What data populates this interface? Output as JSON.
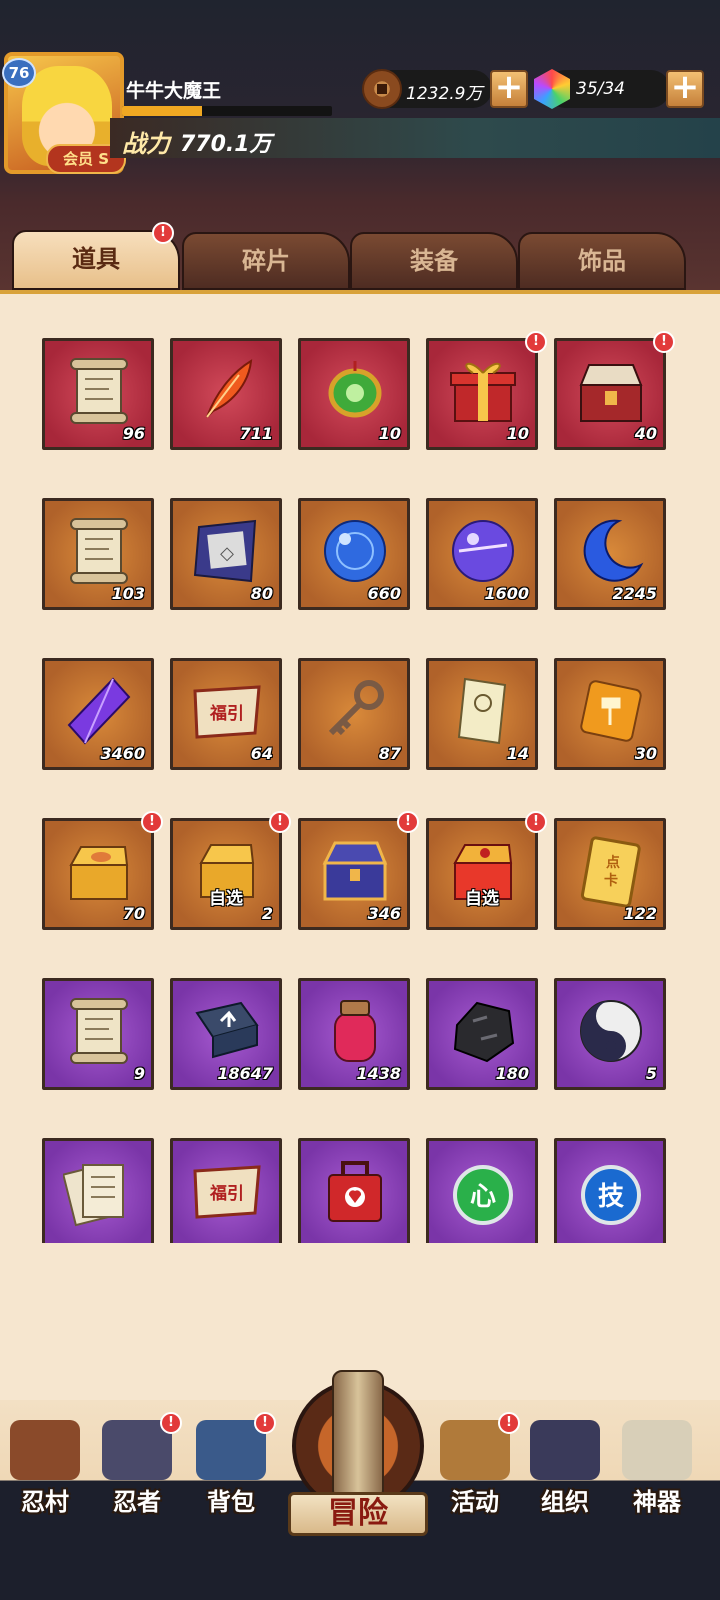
{
  "player": {
    "level": "76",
    "name": "牛牛大魔王",
    "vip_label": "会员",
    "vip_rank": "S",
    "exp_fraction": 0.38,
    "power_label": "战力",
    "power_value": "770.1万"
  },
  "resources": {
    "coins": "1232.9万",
    "gems": "35/34",
    "add_symbol": "+"
  },
  "tabs": [
    {
      "label": "道具",
      "active": true,
      "alert": true
    },
    {
      "label": "碎片",
      "active": false,
      "alert": false
    },
    {
      "label": "装备",
      "active": false,
      "alert": false
    },
    {
      "label": "饰品",
      "active": false,
      "alert": false
    }
  ],
  "alert_symbol": "!",
  "items": [
    {
      "icon": "scroll-icon",
      "rarity": "red",
      "count": "96",
      "tag": "",
      "alert": false
    },
    {
      "icon": "feather-icon",
      "rarity": "red",
      "count": "711",
      "tag": "",
      "alert": false
    },
    {
      "icon": "jade-pendant-icon",
      "rarity": "red",
      "count": "10",
      "tag": "",
      "alert": false
    },
    {
      "icon": "gift-box-icon",
      "rarity": "red",
      "count": "10",
      "tag": "",
      "alert": true
    },
    {
      "icon": "treasure-chest-icon",
      "rarity": "red",
      "count": "40",
      "tag": "",
      "alert": true
    },
    {
      "icon": "scroll-icon",
      "rarity": "orange",
      "count": "103",
      "tag": "",
      "alert": false
    },
    {
      "icon": "cloth-banner-icon",
      "rarity": "orange",
      "count": "80",
      "tag": "",
      "alert": false
    },
    {
      "icon": "blue-orb-icon",
      "rarity": "orange",
      "count": "660",
      "tag": "",
      "alert": false
    },
    {
      "icon": "purple-orb-icon",
      "rarity": "orange",
      "count": "1600",
      "tag": "",
      "alert": false
    },
    {
      "icon": "moon-icon",
      "rarity": "orange",
      "count": "2245",
      "tag": "",
      "alert": false
    },
    {
      "icon": "crystal-icon",
      "rarity": "orange",
      "count": "3460",
      "tag": "",
      "alert": false
    },
    {
      "icon": "fortune-ticket-icon",
      "rarity": "orange",
      "count": "64",
      "tag": "",
      "alert": false
    },
    {
      "icon": "key-icon",
      "rarity": "orange",
      "count": "87",
      "tag": "",
      "alert": false
    },
    {
      "icon": "paper-talisman-icon",
      "rarity": "orange",
      "count": "14",
      "tag": "",
      "alert": false
    },
    {
      "icon": "amber-hammer-icon",
      "rarity": "orange",
      "count": "30",
      "tag": "",
      "alert": false
    },
    {
      "icon": "gold-box-icon",
      "rarity": "orange",
      "count": "70",
      "tag": "",
      "alert": true
    },
    {
      "icon": "select-box-icon",
      "rarity": "orange",
      "count": "2",
      "tag": "自选",
      "alert": true
    },
    {
      "icon": "blue-chest-icon",
      "rarity": "orange",
      "count": "346",
      "tag": "",
      "alert": true
    },
    {
      "icon": "red-select-box-icon",
      "rarity": "orange",
      "count": "",
      "tag": "自选",
      "alert": true
    },
    {
      "icon": "point-card-icon",
      "rarity": "orange",
      "count": "122",
      "tag": "",
      "alert": false
    },
    {
      "icon": "scroll-icon",
      "rarity": "purple",
      "count": "9",
      "tag": "",
      "alert": false
    },
    {
      "icon": "book-icon",
      "rarity": "purple",
      "count": "18647",
      "tag": "",
      "alert": false
    },
    {
      "icon": "jar-icon",
      "rarity": "purple",
      "count": "1438",
      "tag": "",
      "alert": false
    },
    {
      "icon": "ore-icon",
      "rarity": "purple",
      "count": "180",
      "tag": "",
      "alert": false
    },
    {
      "icon": "yin-yang-icon",
      "rarity": "purple",
      "count": "5",
      "tag": "",
      "alert": false
    },
    {
      "icon": "papers-icon",
      "rarity": "purple",
      "count": "",
      "tag": "",
      "alert": false
    },
    {
      "icon": "fortune-ticket-icon",
      "rarity": "purple",
      "count": "",
      "tag": "",
      "alert": false
    },
    {
      "icon": "red-bag-icon",
      "rarity": "purple",
      "count": "",
      "tag": "",
      "alert": false
    },
    {
      "icon": "green-heart-orb-icon",
      "rarity": "purple",
      "count": "",
      "tag": "",
      "alert": false
    },
    {
      "icon": "blue-skill-orb-icon",
      "rarity": "purple",
      "count": "",
      "tag": "",
      "alert": false
    }
  ],
  "item_glyphs": {
    "fortune_ticket": "福引",
    "heart": "心",
    "skill": "技",
    "point_card": "点卡"
  },
  "nav": [
    {
      "label": "忍村",
      "icon": "village-gate-icon",
      "alert": false
    },
    {
      "label": "忍者",
      "icon": "ninja-icon",
      "alert": true
    },
    {
      "label": "背包",
      "icon": "backpack-icon",
      "alert": true
    },
    {
      "label": "活动",
      "icon": "drum-icon",
      "alert": true
    },
    {
      "label": "组织",
      "icon": "group-icon",
      "alert": false
    },
    {
      "label": "神器",
      "icon": "artifact-scroll-icon",
      "alert": false
    }
  ],
  "adventure_label": "冒险",
  "colors": {
    "red_frame": "#a8273a",
    "orange_frame": "#b0622a",
    "purple_frame": "#7a35a8",
    "alert": "#e23a3a",
    "panel_bg": "#f6e6cf"
  }
}
